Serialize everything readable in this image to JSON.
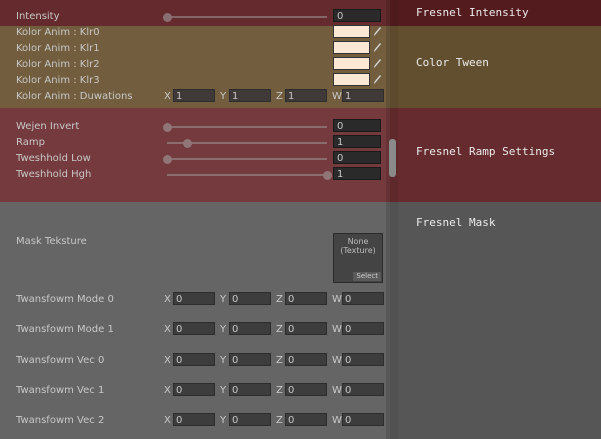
{
  "sections": {
    "intensity": "Fresnel Intensity",
    "color": "Color Tween",
    "ramp": "Fresnel Ramp Settings",
    "mask": "Fresnel Mask"
  },
  "intensity_row": {
    "label": "Intensity",
    "value": "0",
    "slider_fraction": 0.0
  },
  "color_rows": [
    {
      "label": "Kolor Anim : Klr0",
      "color": "#fbe7d3"
    },
    {
      "label": "Kolor Anim : Klr1",
      "color": "#fbe7d3"
    },
    {
      "label": "Kolor Anim : Klr2",
      "color": "#fbe7d3"
    },
    {
      "label": "Kolor Anim : Klr3",
      "color": "#fbe7d3"
    }
  ],
  "durations": {
    "label": "Kolor Anim : Duwations",
    "x": "1",
    "y": "1",
    "z": "1",
    "w": "1"
  },
  "axes": {
    "x": "X",
    "y": "Y",
    "z": "Z",
    "w": "W"
  },
  "ramp_rows": [
    {
      "label": "Wejen Invert",
      "value": "0",
      "slider_fraction": 0.0
    },
    {
      "label": "Ramp",
      "value": "1",
      "slider_fraction": 0.125
    },
    {
      "label": "Tweshhold Low",
      "value": "0",
      "slider_fraction": 0.0
    },
    {
      "label": "Tweshhold Hgh",
      "value": "1",
      "slider_fraction": 1.0
    }
  ],
  "mask": {
    "texture_label": "Mask Teksture",
    "texture_none": "None",
    "texture_type": "(Texture)",
    "select_label": "Select",
    "vectors": [
      {
        "label": "Twansfowm Mode 0",
        "x": "0",
        "y": "0",
        "z": "0",
        "w": "0"
      },
      {
        "label": "Twansfowm Mode 1",
        "x": "0",
        "y": "0",
        "z": "0",
        "w": "0"
      },
      {
        "label": "Twansfowm Vec 0",
        "x": "0",
        "y": "0",
        "z": "0",
        "w": "0"
      },
      {
        "label": "Twansfowm Vec 1",
        "x": "0",
        "y": "0",
        "z": "0",
        "w": "0"
      },
      {
        "label": "Twansfowm Vec 2",
        "x": "0",
        "y": "0",
        "z": "0",
        "w": "0"
      }
    ]
  }
}
